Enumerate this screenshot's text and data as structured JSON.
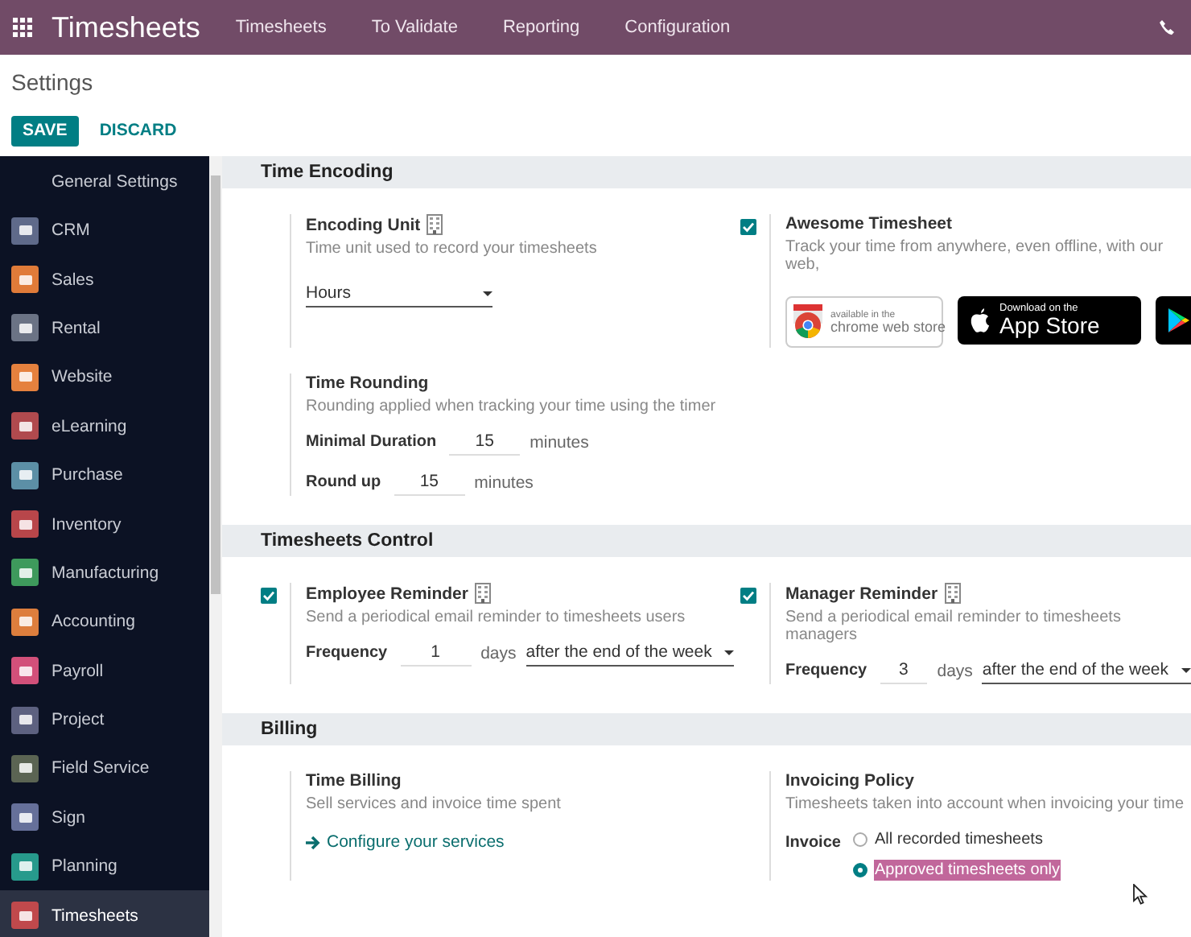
{
  "app": {
    "title": "Timesheets",
    "menu": [
      "Timesheets",
      "To Validate",
      "Reporting",
      "Configuration"
    ]
  },
  "breadcrumb": "Settings",
  "buttons": [
    {
      "label": "SAVE",
      "kind": "primary"
    },
    {
      "label": "DISCARD",
      "kind": "link"
    }
  ],
  "sidebar": {
    "items": [
      {
        "label": "General Settings",
        "kind": "heading",
        "selected": false
      },
      {
        "label": "CRM",
        "kind": "app",
        "color": "#5f6a8a",
        "selected": false
      },
      {
        "label": "Sales",
        "kind": "app",
        "color": "#e07b39",
        "selected": false
      },
      {
        "label": "Rental",
        "kind": "app",
        "color": "#6b7385",
        "selected": false
      },
      {
        "label": "Website",
        "kind": "app",
        "color": "#e5813e",
        "selected": false
      },
      {
        "label": "eLearning",
        "kind": "app",
        "color": "#b04a4e",
        "selected": false
      },
      {
        "label": "Purchase",
        "kind": "app",
        "color": "#5c8fa6",
        "selected": false
      },
      {
        "label": "Inventory",
        "kind": "app",
        "color": "#b8464a",
        "selected": false
      },
      {
        "label": "Manufacturing",
        "kind": "app",
        "color": "#3e9a5c",
        "selected": false
      },
      {
        "label": "Accounting",
        "kind": "app",
        "color": "#dd7e3d",
        "selected": false
      },
      {
        "label": "Payroll",
        "kind": "app",
        "color": "#d2507a",
        "selected": false
      },
      {
        "label": "Project",
        "kind": "app",
        "color": "#5d6180",
        "selected": false
      },
      {
        "label": "Field Service",
        "kind": "app",
        "color": "#5b6453",
        "selected": false
      },
      {
        "label": "Sign",
        "kind": "app",
        "color": "#66709a",
        "selected": false
      },
      {
        "label": "Planning",
        "kind": "app",
        "color": "#279a8c",
        "selected": false
      },
      {
        "label": "Timesheets",
        "kind": "app",
        "color": "#c0494c",
        "selected": true
      }
    ]
  },
  "sections": [
    {
      "title": "Time Encoding",
      "settings": [
        {
          "title": "Encoding Unit",
          "doc_icon": true,
          "description": "Time unit used to record your timesheets",
          "controls": [
            {
              "kind": "select",
              "value": "Hours"
            }
          ]
        },
        {
          "checked": true,
          "title": "Awesome Timesheet",
          "doc_icon": false,
          "description": "Track your time from anywhere, even offline, with our web,",
          "controls": [
            {
              "kind": "badges",
              "items": [
                {
                  "kind": "chrome",
                  "lines": [
                    "available in the",
                    "chrome web store"
                  ]
                },
                {
                  "kind": "appstore",
                  "lines": [
                    "Download on the",
                    "App Store"
                  ]
                },
                {
                  "kind": "googleplay"
                }
              ]
            }
          ]
        },
        {
          "title": "Time Rounding",
          "doc_icon": false,
          "description": "Rounding applied when tracking your time using the timer",
          "controls": [
            {
              "kind": "row",
              "label": "Minimal Duration",
              "value": "15",
              "unit": "minutes"
            },
            {
              "kind": "row",
              "label": "Round up",
              "value": "15",
              "unit": "minutes"
            }
          ]
        }
      ]
    },
    {
      "title": "Timesheets Control",
      "settings": [
        {
          "checked": true,
          "title": "Employee Reminder",
          "doc_icon": true,
          "description": "Send a periodical email reminder to timesheets users",
          "controls": [
            {
              "kind": "row",
              "label": "Frequency",
              "value": "1",
              "unit": "days",
              "select": "after the end of the week"
            }
          ]
        },
        {
          "checked": true,
          "title": "Manager Reminder",
          "doc_icon": true,
          "description": "Send a periodical email reminder to timesheets managers",
          "controls": [
            {
              "kind": "row",
              "label": "Frequency",
              "value": "3",
              "unit": "days",
              "select": "after the end of the week"
            }
          ]
        }
      ]
    },
    {
      "title": "Billing",
      "settings": [
        {
          "title": "Time Billing",
          "doc_icon": false,
          "description": "Sell services and invoice time spent",
          "controls": [
            {
              "kind": "link",
              "label": "Configure your services"
            }
          ]
        },
        {
          "title": "Invoicing Policy",
          "doc_icon": false,
          "description": "Timesheets taken into account when invoicing your time",
          "controls": [
            {
              "kind": "radio",
              "label": "Invoice",
              "options": [
                {
                  "label": "All recorded timesheets",
                  "selected": false,
                  "highlighted": false
                },
                {
                  "label": "Approved timesheets only",
                  "selected": true,
                  "highlighted": true
                }
              ]
            }
          ]
        }
      ]
    }
  ]
}
